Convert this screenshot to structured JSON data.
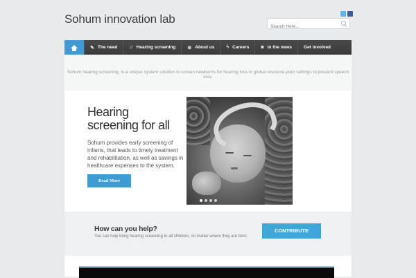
{
  "header": {
    "site_title": "Sohum innovation lab",
    "search_placeholder": "Search Here..."
  },
  "nav": {
    "items": [
      {
        "label": "The need",
        "icon": "pencil-icon"
      },
      {
        "label": "Hearing screening",
        "icon": "music-note-icon"
      },
      {
        "label": "About us",
        "icon": "x-circle-icon"
      },
      {
        "label": "Careers",
        "icon": "lightning-icon"
      },
      {
        "label": "In the news",
        "icon": "camera-icon"
      },
      {
        "label": "Get involved",
        "icon": ""
      }
    ]
  },
  "tagline": "Sohum hearing screening, is a unique system solution to screen newborns for hearing loss in global resource-poor settings to prevent speech loss.",
  "hero": {
    "title": "Hearing screening for all",
    "body": "Sohum provides early screening of infants, that leads to timely treatment and rehabilitation, as well as savings in healthcare expenses to the system.",
    "button_label": "Read More",
    "slide_count": 4,
    "active_slide": 1
  },
  "help": {
    "heading": "How can you help?",
    "text": "You can help bring hearing screening to all children, no matter where they are born.",
    "button_label": "CONTRIBUTE"
  },
  "colors": {
    "accent": "#3e9cd3",
    "nav_bg": "#444444",
    "background": "#e9eaeb"
  }
}
